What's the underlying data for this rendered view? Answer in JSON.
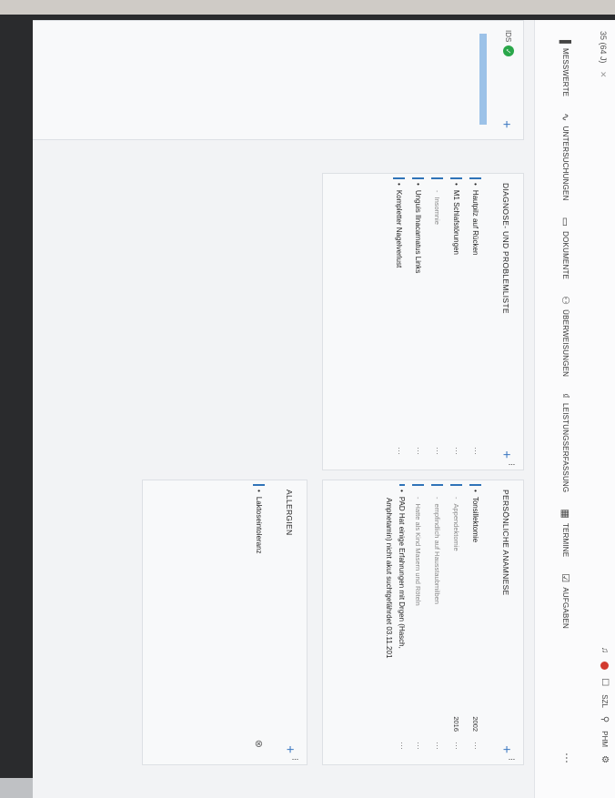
{
  "header": {
    "patient_tab": "35 (64 J)",
    "user_initials": "SZL",
    "user_name": "PHM"
  },
  "nav": [
    {
      "label": "MESSWERTE",
      "icon": "chart-icon"
    },
    {
      "label": "UNTERSUCHUNGEN",
      "icon": "pulse-icon"
    },
    {
      "label": "DOKUMENTE",
      "icon": "document-icon"
    },
    {
      "label": "ÜBERWEISUNGEN",
      "icon": "referral-icon"
    },
    {
      "label": "LEISTUNGSERFASSUNG",
      "icon": "billing-icon"
    },
    {
      "label": "TERMINE",
      "icon": "calendar-icon"
    },
    {
      "label": "AUFGABEN",
      "icon": "tasks-icon"
    }
  ],
  "left_panel": {
    "badge": "IDS"
  },
  "diagnose": {
    "title": "DIAGNOSE- UND PROBLEMLISTE",
    "items": [
      {
        "text": "Hautpilz auf Rücken",
        "sub": false
      },
      {
        "text": "M1 Schlafstörungen",
        "sub": false
      },
      {
        "text": "Insomnie",
        "sub": true
      },
      {
        "text": "Unguis Ilnacarnatus Links",
        "sub": false
      },
      {
        "text": "Kompletter Nagelverlust",
        "sub": false
      }
    ]
  },
  "anamnese": {
    "title": "PERSÖNLICHE ANAMNESE",
    "items": [
      {
        "text": "Tonsillektomie",
        "year": "2002",
        "sub": false
      },
      {
        "text": "Appendektomie",
        "year": "2016",
        "sub": true
      },
      {
        "text": "empfindlich auf Hausstaubmilben",
        "year": "",
        "sub": true
      },
      {
        "text": "Hatte als Kind Masern und Röteln",
        "year": "",
        "sub": true
      },
      {
        "text": "PAD Hat einige Erfahrungen mit Drgen (Hasch,",
        "year": "",
        "sub": false
      },
      {
        "text": "Amphetamin) nicht akut suchtgefährdet 03.11.201",
        "year": "",
        "sub": false
      }
    ]
  },
  "allergien": {
    "title": "ALLERGIEN",
    "items": [
      {
        "text": "Laktoseintoleranz"
      }
    ]
  }
}
